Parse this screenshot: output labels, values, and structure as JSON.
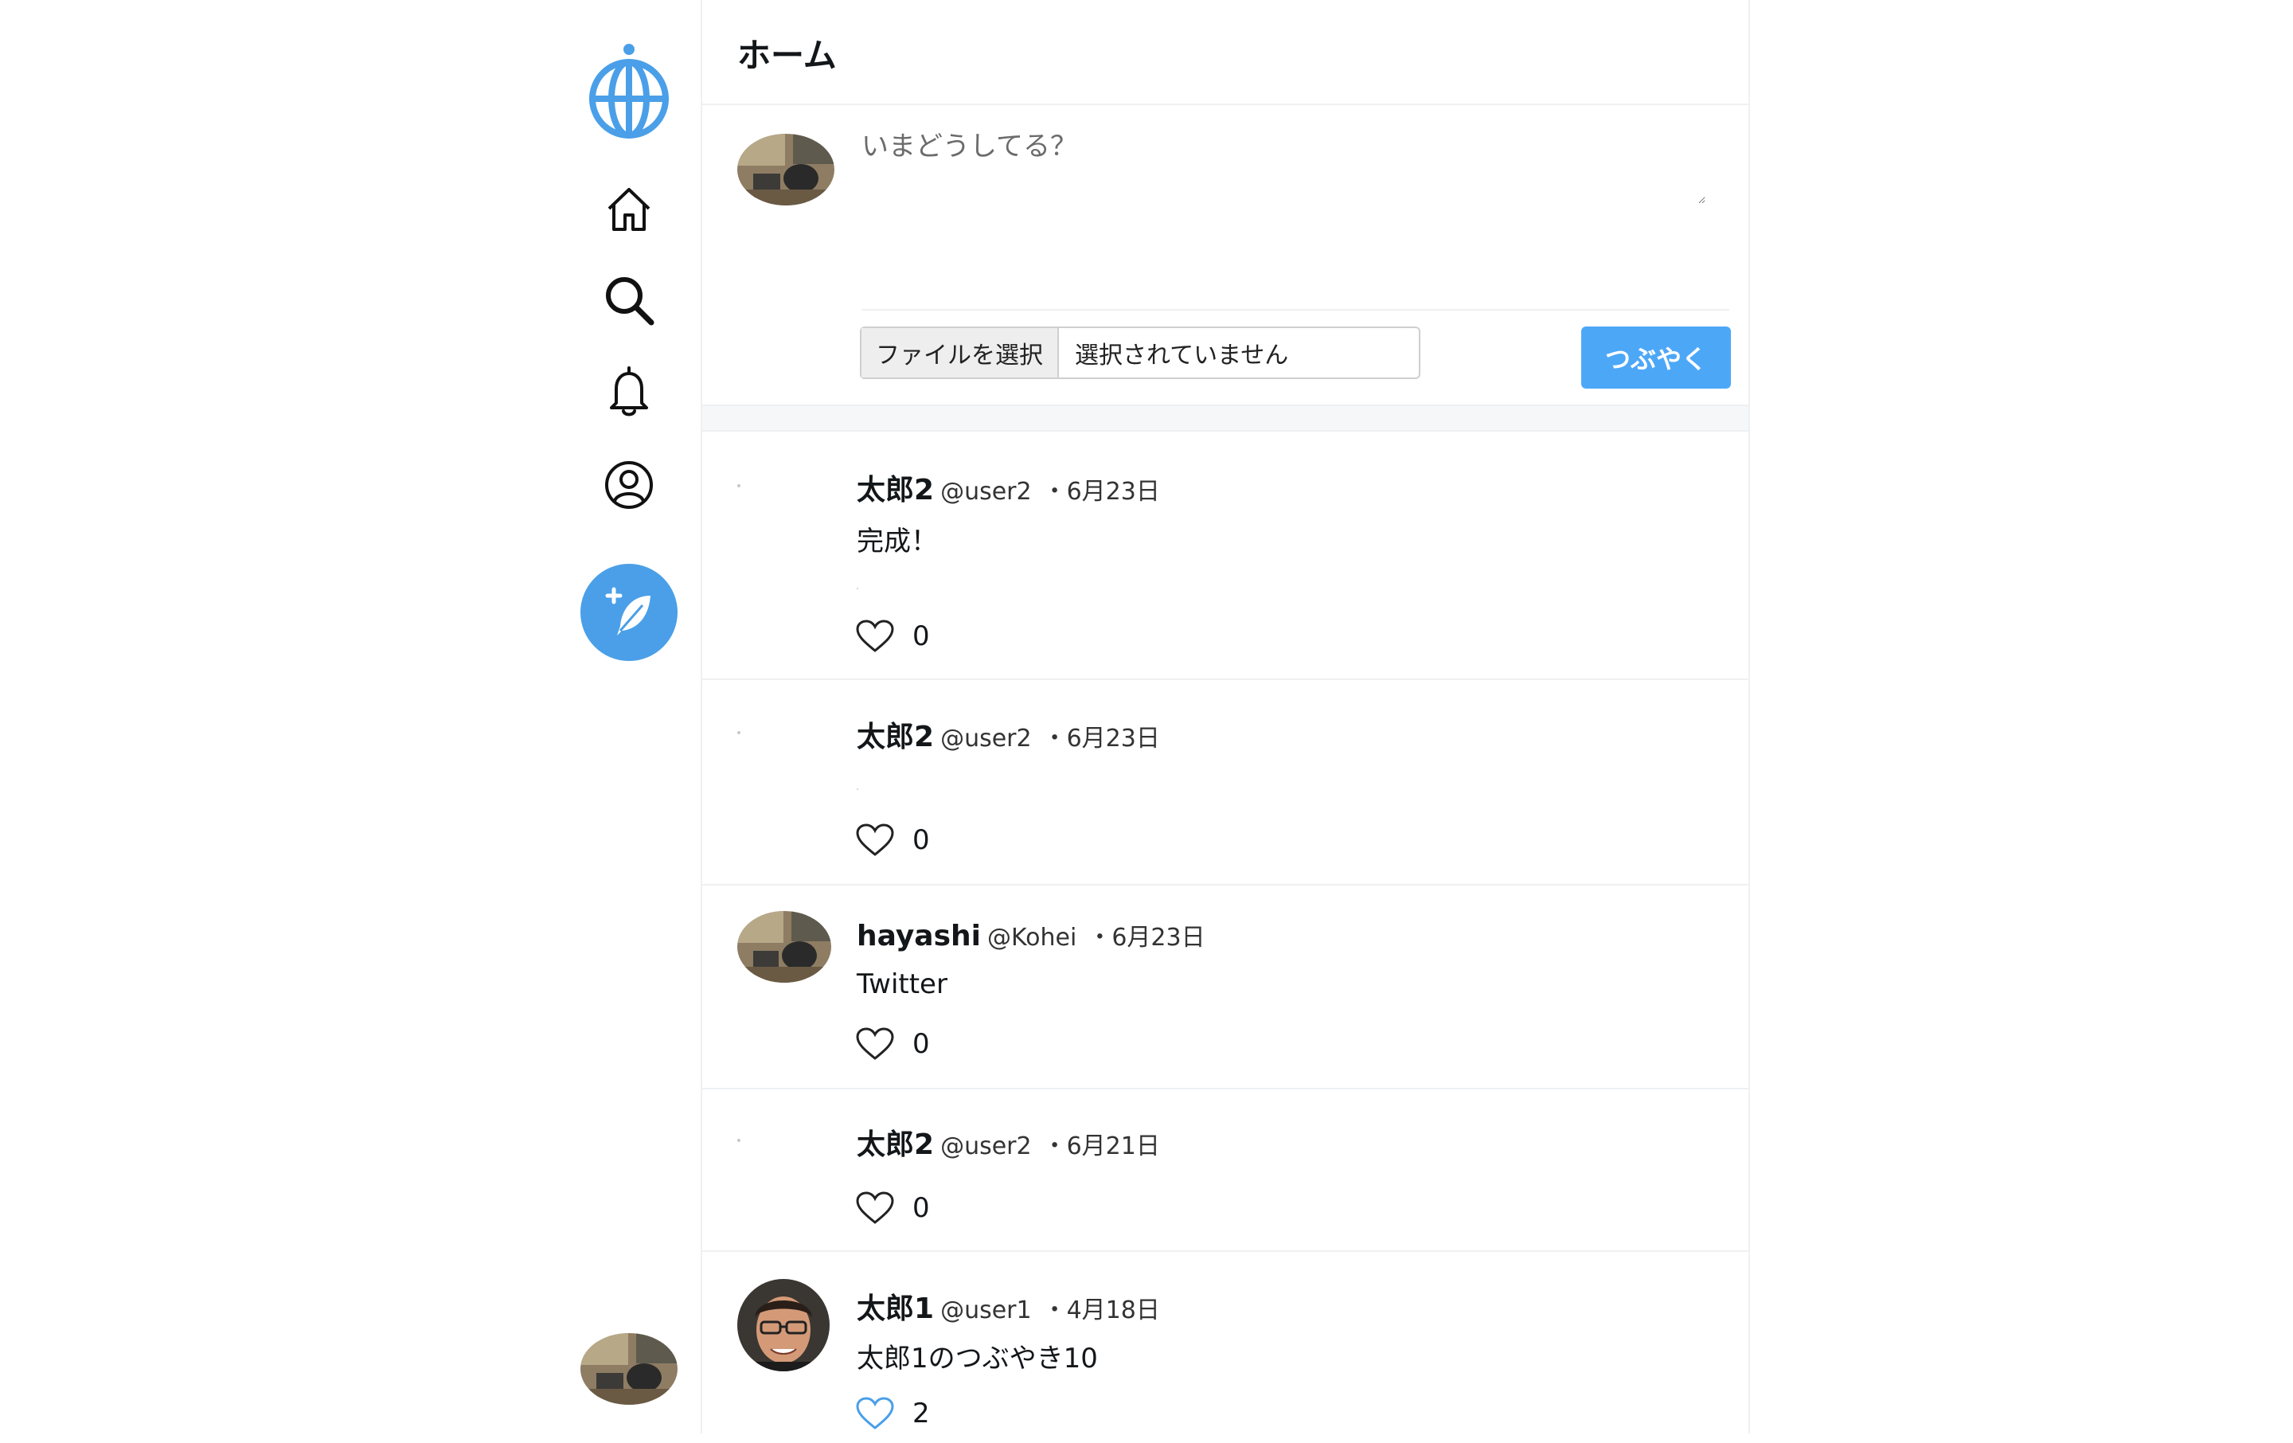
{
  "nav": {
    "icons": [
      "globe-logo-icon",
      "home-icon",
      "search-icon",
      "bell-icon",
      "profile-icon",
      "compose-feather-icon"
    ],
    "accent_color": "#4a9fe8"
  },
  "header": {
    "title": "ホーム"
  },
  "composer": {
    "placeholder": "いまどうしてる？",
    "file_button_label": "ファイルを選択",
    "file_status": "選択されていません",
    "submit_label": "つぶやく",
    "submit_color": "#4da7f7"
  },
  "tweets": [
    {
      "name": "太郎2",
      "handle": "@user2",
      "date": "・6月23日",
      "text": "完成！",
      "likes": "0",
      "liked": false
    },
    {
      "name": "太郎2",
      "handle": "@user2",
      "date": "・6月23日",
      "text": "",
      "likes": "0",
      "liked": false
    },
    {
      "name": "hayashi",
      "handle": "@Kohei",
      "date": "・6月23日",
      "text": "Twitter",
      "likes": "0",
      "liked": false
    },
    {
      "name": "太郎2",
      "handle": "@user2",
      "date": "・6月21日",
      "text": "",
      "likes": "0",
      "liked": false
    },
    {
      "name": "太郎1",
      "handle": "@user1",
      "date": "・4月18日",
      "text": "太郎1のつぶやき10",
      "likes": "2",
      "liked": true
    }
  ]
}
